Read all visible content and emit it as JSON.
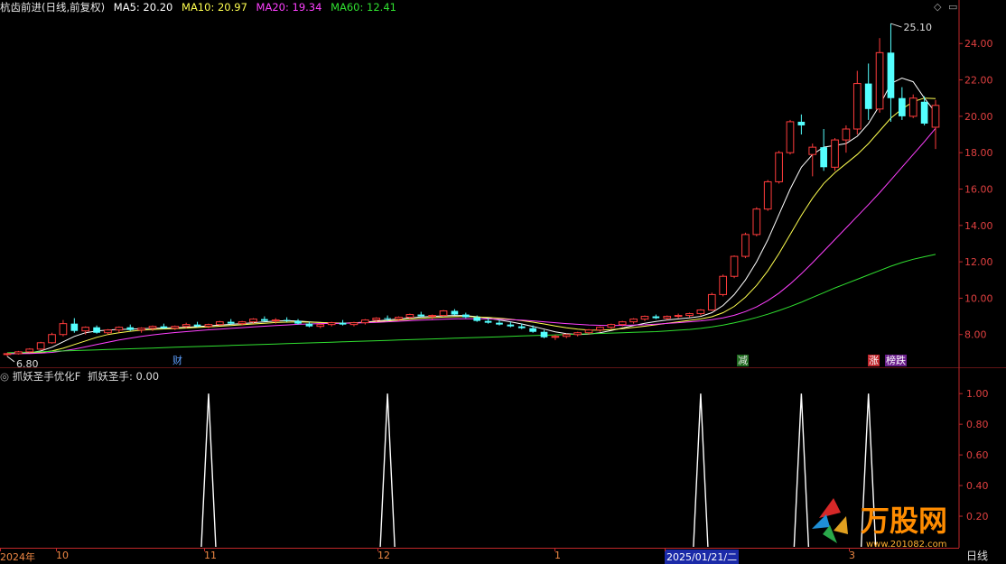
{
  "header": {
    "stock_title": "杭齿前进(日线,前复权)",
    "ma5": "MA5: 20.20",
    "ma10": "MA10: 20.97",
    "ma20": "MA20: 19.34",
    "ma60": "MA60: 12.41",
    "settings_icon": "diamond-icon",
    "restore_icon": "window-restore-icon"
  },
  "sub_header": {
    "indicator_title": "抓妖圣手优化F",
    "indicator_value": "抓妖圣手: 0.00"
  },
  "markers": {
    "cai": "财",
    "jian": "减",
    "zhang": "涨",
    "bangdie": "榜跌",
    "high_label": "25.10",
    "low_label": "6.80"
  },
  "x_axis_labels": [
    "2024年",
    "10",
    "11",
    "12",
    "1",
    "2025/01/21/二",
    "3"
  ],
  "period_button": "日线",
  "watermark": {
    "brand": "万股网",
    "url": "www.201082.com"
  },
  "colors": {
    "background": "#000000",
    "up": "#ff3c3c",
    "down": "#54ffff",
    "ma5": "#ffffff",
    "ma10": "#ffff50",
    "ma20": "#ff40ff",
    "ma60": "#30e030",
    "axis": "#c0282a",
    "signal": "#ffffff"
  },
  "chart_data": [
    {
      "type": "candlestick",
      "title": "杭齿前进(日线,前复权)",
      "y_ticks": [
        8.0,
        10.0,
        12.0,
        14.0,
        16.0,
        18.0,
        20.0,
        22.0,
        24.0
      ],
      "ylim": [
        6.3,
        25.6
      ],
      "annotations": {
        "high": 25.1,
        "low": 6.8
      },
      "ohlc": [
        [
          6.9,
          7.0,
          6.8,
          6.95
        ],
        [
          6.95,
          7.1,
          6.9,
          7.05
        ],
        [
          7.05,
          7.25,
          7.0,
          7.2
        ],
        [
          7.2,
          7.6,
          7.15,
          7.55
        ],
        [
          7.55,
          8.1,
          7.5,
          8.0
        ],
        [
          8.0,
          8.8,
          7.9,
          8.6
        ],
        [
          8.6,
          8.9,
          8.1,
          8.2
        ],
        [
          8.2,
          8.45,
          8.0,
          8.4
        ],
        [
          8.4,
          8.5,
          8.05,
          8.1
        ],
        [
          8.1,
          8.3,
          8.0,
          8.25
        ],
        [
          8.25,
          8.45,
          8.1,
          8.4
        ],
        [
          8.4,
          8.55,
          8.2,
          8.25
        ],
        [
          8.25,
          8.4,
          8.1,
          8.35
        ],
        [
          8.35,
          8.5,
          8.2,
          8.45
        ],
        [
          8.45,
          8.6,
          8.3,
          8.35
        ],
        [
          8.35,
          8.5,
          8.25,
          8.45
        ],
        [
          8.45,
          8.65,
          8.35,
          8.55
        ],
        [
          8.55,
          8.7,
          8.4,
          8.45
        ],
        [
          8.45,
          8.6,
          8.35,
          8.55
        ],
        [
          8.55,
          8.75,
          8.5,
          8.7
        ],
        [
          8.7,
          8.85,
          8.55,
          8.6
        ],
        [
          8.6,
          8.75,
          8.5,
          8.7
        ],
        [
          8.7,
          8.9,
          8.6,
          8.85
        ],
        [
          8.85,
          9.0,
          8.7,
          8.75
        ],
        [
          8.75,
          8.9,
          8.6,
          8.8
        ],
        [
          8.8,
          8.95,
          8.7,
          8.75
        ],
        [
          8.75,
          8.85,
          8.55,
          8.6
        ],
        [
          8.6,
          8.7,
          8.4,
          8.45
        ],
        [
          8.45,
          8.6,
          8.35,
          8.55
        ],
        [
          8.55,
          8.7,
          8.45,
          8.65
        ],
        [
          8.65,
          8.8,
          8.5,
          8.55
        ],
        [
          8.55,
          8.7,
          8.45,
          8.65
        ],
        [
          8.65,
          8.85,
          8.55,
          8.8
        ],
        [
          8.8,
          8.95,
          8.7,
          8.9
        ],
        [
          8.9,
          9.05,
          8.75,
          8.85
        ],
        [
          8.85,
          9.0,
          8.75,
          8.95
        ],
        [
          8.95,
          9.15,
          8.85,
          9.1
        ],
        [
          9.1,
          9.25,
          8.95,
          9.0
        ],
        [
          9.0,
          9.1,
          8.85,
          9.05
        ],
        [
          9.05,
          9.35,
          9.0,
          9.3
        ],
        [
          9.3,
          9.4,
          9.05,
          9.1
        ],
        [
          9.1,
          9.2,
          8.9,
          8.95
        ],
        [
          8.95,
          9.05,
          8.7,
          8.75
        ],
        [
          8.75,
          8.9,
          8.6,
          8.65
        ],
        [
          8.65,
          8.8,
          8.5,
          8.55
        ],
        [
          8.55,
          8.7,
          8.4,
          8.45
        ],
        [
          8.45,
          8.6,
          8.3,
          8.35
        ],
        [
          8.35,
          8.5,
          8.1,
          8.15
        ],
        [
          8.15,
          8.25,
          7.8,
          7.85
        ],
        [
          7.85,
          8.0,
          7.7,
          7.9
        ],
        [
          7.9,
          8.05,
          7.8,
          8.0
        ],
        [
          8.0,
          8.15,
          7.9,
          8.1
        ],
        [
          8.1,
          8.3,
          8.0,
          8.25
        ],
        [
          8.25,
          8.45,
          8.15,
          8.4
        ],
        [
          8.4,
          8.6,
          8.3,
          8.55
        ],
        [
          8.55,
          8.75,
          8.45,
          8.7
        ],
        [
          8.7,
          8.9,
          8.6,
          8.85
        ],
        [
          8.85,
          9.05,
          8.75,
          9.0
        ],
        [
          9.0,
          9.1,
          8.85,
          8.9
        ],
        [
          8.9,
          9.05,
          8.8,
          9.0
        ],
        [
          9.0,
          9.15,
          8.9,
          9.05
        ],
        [
          9.05,
          9.2,
          8.95,
          9.15
        ],
        [
          9.15,
          9.4,
          9.05,
          9.35
        ],
        [
          9.35,
          10.3,
          9.3,
          10.2
        ],
        [
          10.2,
          11.3,
          10.1,
          11.2
        ],
        [
          11.2,
          12.35,
          11.1,
          12.3
        ],
        [
          12.3,
          13.6,
          12.2,
          13.5
        ],
        [
          13.5,
          15.0,
          13.4,
          14.9
        ],
        [
          14.9,
          16.5,
          14.8,
          16.4
        ],
        [
          16.4,
          18.1,
          16.3,
          18.0
        ],
        [
          18.0,
          19.8,
          17.9,
          19.7
        ],
        [
          19.7,
          20.1,
          19.0,
          19.5
        ],
        [
          17.9,
          18.5,
          16.7,
          18.3
        ],
        [
          18.3,
          19.3,
          17.0,
          17.2
        ],
        [
          17.2,
          18.8,
          17.0,
          18.7
        ],
        [
          18.7,
          19.5,
          18.0,
          19.3
        ],
        [
          19.3,
          22.5,
          19.0,
          21.8
        ],
        [
          21.8,
          22.9,
          19.8,
          20.4
        ],
        [
          20.4,
          24.3,
          20.2,
          23.5
        ],
        [
          23.5,
          25.1,
          19.7,
          21.0
        ],
        [
          21.0,
          21.6,
          19.8,
          20.0
        ],
        [
          20.0,
          21.2,
          19.9,
          21.0
        ],
        [
          20.8,
          21.1,
          19.5,
          19.6
        ],
        [
          19.4,
          20.9,
          18.2,
          20.6
        ]
      ],
      "ma5": [
        6.95,
        6.97,
        7.0,
        7.1,
        7.3,
        7.6,
        7.9,
        8.1,
        8.2,
        8.25,
        8.28,
        8.3,
        8.32,
        8.34,
        8.36,
        8.38,
        8.4,
        8.44,
        8.48,
        8.52,
        8.56,
        8.6,
        8.65,
        8.7,
        8.74,
        8.76,
        8.74,
        8.7,
        8.66,
        8.62,
        8.62,
        8.64,
        8.68,
        8.74,
        8.8,
        8.86,
        8.92,
        8.97,
        9.0,
        9.03,
        9.05,
        9.04,
        8.98,
        8.9,
        8.8,
        8.7,
        8.58,
        8.45,
        8.3,
        8.15,
        8.05,
        8.0,
        8.02,
        8.1,
        8.22,
        8.36,
        8.5,
        8.62,
        8.72,
        8.8,
        8.86,
        8.92,
        9.0,
        9.2,
        9.6,
        10.2,
        11.0,
        12.0,
        13.2,
        14.6,
        16.0,
        17.2,
        17.9,
        18.3,
        18.4,
        18.5,
        18.9,
        19.6,
        20.6,
        21.8,
        22.1,
        21.9,
        21.0,
        20.2
      ],
      "ma10": [
        6.95,
        6.96,
        6.98,
        7.02,
        7.1,
        7.25,
        7.45,
        7.65,
        7.85,
        8.0,
        8.1,
        8.18,
        8.24,
        8.28,
        8.31,
        8.33,
        8.36,
        8.39,
        8.42,
        8.46,
        8.5,
        8.54,
        8.58,
        8.62,
        8.66,
        8.68,
        8.69,
        8.68,
        8.66,
        8.64,
        8.63,
        8.64,
        8.66,
        8.7,
        8.74,
        8.79,
        8.84,
        8.89,
        8.93,
        8.96,
        8.98,
        8.99,
        8.97,
        8.94,
        8.9,
        8.84,
        8.77,
        8.68,
        8.58,
        8.47,
        8.37,
        8.3,
        8.25,
        8.24,
        8.27,
        8.32,
        8.39,
        8.46,
        8.54,
        8.62,
        8.7,
        8.78,
        8.86,
        8.98,
        9.2,
        9.55,
        10.05,
        10.7,
        11.5,
        12.45,
        13.5,
        14.55,
        15.5,
        16.3,
        16.9,
        17.4,
        17.9,
        18.5,
        19.2,
        19.9,
        20.4,
        20.8,
        21.0,
        20.97
      ],
      "ma20": [
        6.95,
        6.95,
        6.96,
        6.98,
        7.02,
        7.1,
        7.2,
        7.32,
        7.45,
        7.58,
        7.7,
        7.8,
        7.9,
        7.98,
        8.05,
        8.11,
        8.16,
        8.21,
        8.26,
        8.3,
        8.34,
        8.38,
        8.42,
        8.46,
        8.5,
        8.53,
        8.56,
        8.58,
        8.6,
        8.61,
        8.62,
        8.63,
        8.65,
        8.67,
        8.7,
        8.73,
        8.76,
        8.79,
        8.82,
        8.84,
        8.86,
        8.87,
        8.87,
        8.86,
        8.84,
        8.82,
        8.79,
        8.75,
        8.7,
        8.65,
        8.6,
        8.56,
        8.53,
        8.51,
        8.5,
        8.51,
        8.52,
        8.54,
        8.57,
        8.61,
        8.65,
        8.7,
        8.75,
        8.82,
        8.92,
        9.06,
        9.26,
        9.52,
        9.86,
        10.28,
        10.78,
        11.34,
        11.95,
        12.58,
        13.22,
        13.86,
        14.5,
        15.14,
        15.8,
        16.5,
        17.2,
        17.9,
        18.6,
        19.34
      ],
      "ma60": [
        7.0,
        7.02,
        7.04,
        7.06,
        7.08,
        7.1,
        7.12,
        7.14,
        7.16,
        7.18,
        7.2,
        7.22,
        7.24,
        7.26,
        7.28,
        7.3,
        7.32,
        7.34,
        7.36,
        7.38,
        7.4,
        7.42,
        7.44,
        7.46,
        7.48,
        7.5,
        7.52,
        7.54,
        7.56,
        7.58,
        7.6,
        7.62,
        7.64,
        7.66,
        7.68,
        7.7,
        7.72,
        7.74,
        7.76,
        7.78,
        7.8,
        7.82,
        7.84,
        7.86,
        7.88,
        7.9,
        7.92,
        7.94,
        7.96,
        7.98,
        8.0,
        8.02,
        8.04,
        8.06,
        8.08,
        8.1,
        8.12,
        8.14,
        8.16,
        8.2,
        8.24,
        8.28,
        8.34,
        8.42,
        8.52,
        8.64,
        8.78,
        8.94,
        9.12,
        9.32,
        9.54,
        9.78,
        10.04,
        10.3,
        10.56,
        10.8,
        11.04,
        11.28,
        11.52,
        11.76,
        11.96,
        12.14,
        12.28,
        12.41
      ]
    },
    {
      "type": "line",
      "title": "抓妖圣手优化F",
      "series": [
        {
          "name": "抓妖圣手",
          "values": [
            1,
            1,
            1,
            1,
            1
          ]
        }
      ],
      "spike_bars": [
        18,
        34,
        62,
        71,
        77
      ],
      "y_ticks": [
        0.2,
        0.4,
        0.6,
        0.8,
        1.0
      ],
      "ylim": [
        0,
        1.06
      ]
    }
  ]
}
